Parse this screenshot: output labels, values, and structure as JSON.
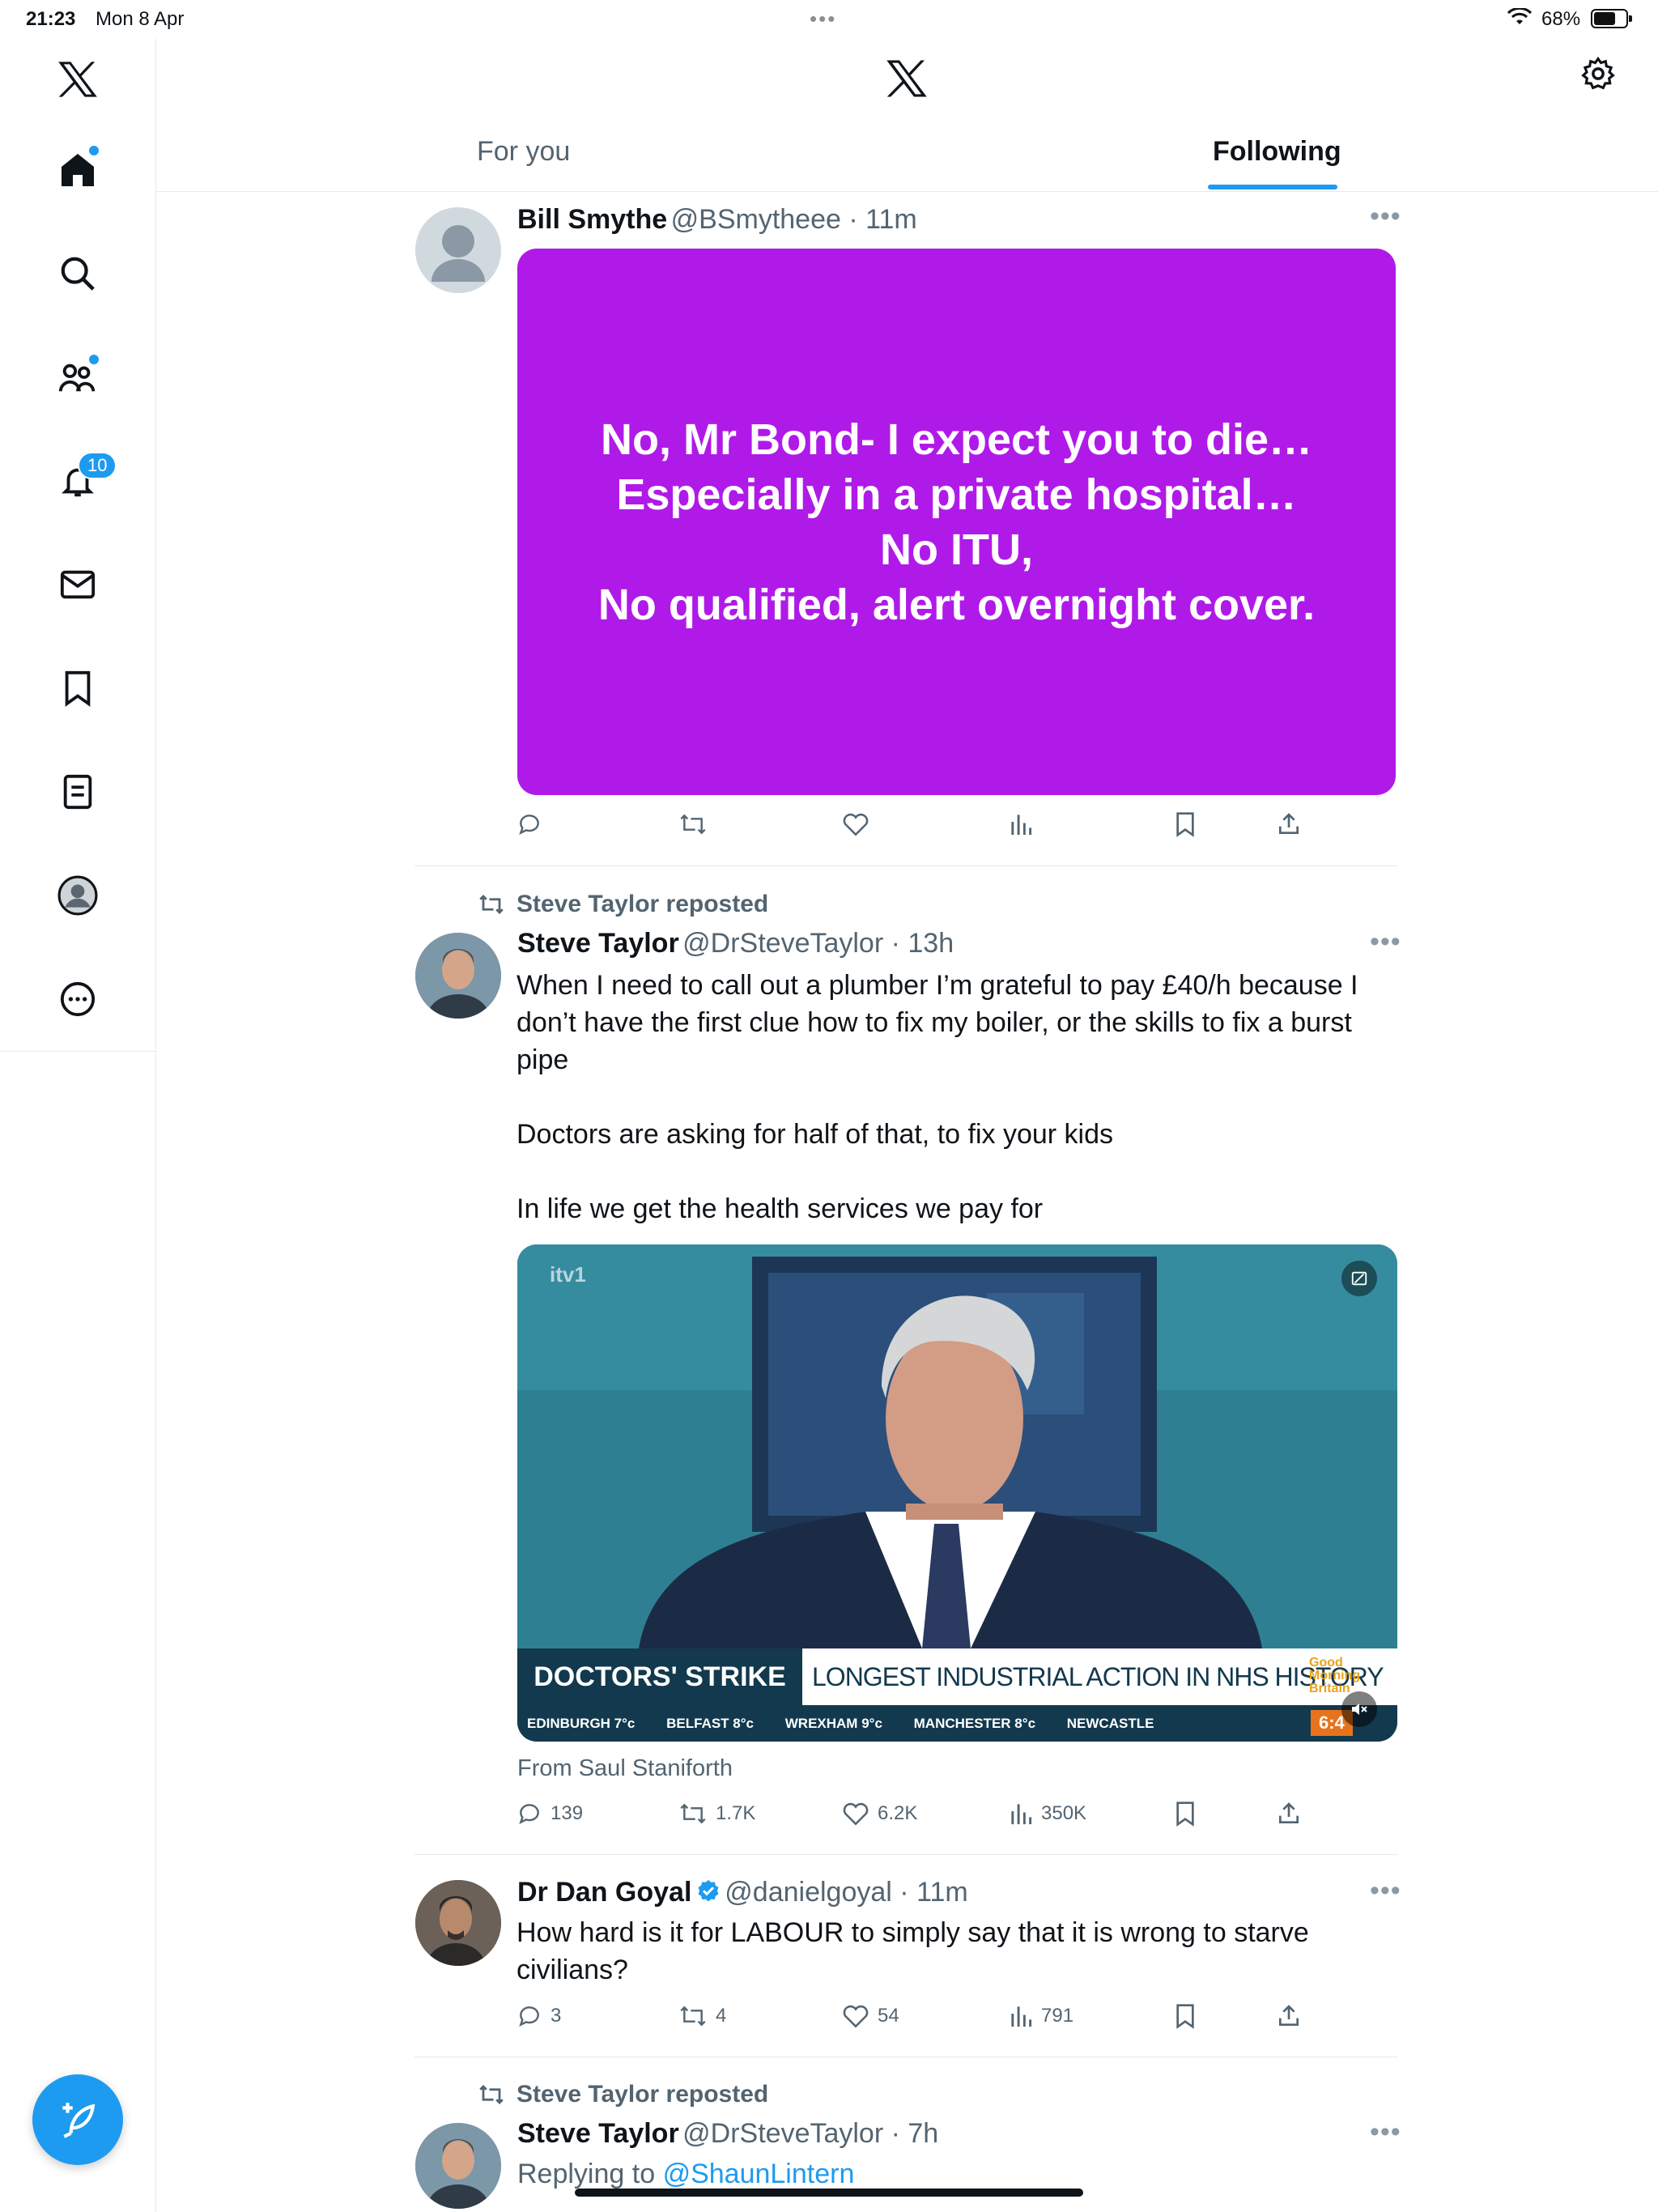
{
  "status_bar": {
    "time": "21:23",
    "date": "Mon 8 Apr",
    "battery": "68%",
    "battery_level": 0.68
  },
  "sidebar": {
    "notifications_badge": "10",
    "items": [
      "home",
      "explore",
      "communities",
      "notifications",
      "messages",
      "bookmarks",
      "lists",
      "profile",
      "more"
    ]
  },
  "header": {
    "tabs": [
      {
        "label": "For you",
        "active": false
      },
      {
        "label": "Following",
        "active": true
      }
    ]
  },
  "feed": [
    {
      "name": "Bill Smythe",
      "handle": "@BSmytheee",
      "time": "11m",
      "card_lines": [
        "No, Mr Bond- I expect you to die…",
        "Especially in a private hospital…",
        "No ITU,",
        "No qualified, alert overnight cover."
      ],
      "card_color": "#b01ae8"
    },
    {
      "reposted_by": "Steve Taylor reposted",
      "name": "Steve Taylor",
      "handle": "@DrSteveTaylor",
      "time": "13h",
      "text_lines": [
        "When I need to call out a plumber I’m grateful to pay £40/h because I",
        "don’t have the first clue how to fix my boiler, or the skills to fix a burst",
        "pipe",
        "Doctors are asking for half of that, to fix your kids",
        "In life we get the health services we pay for"
      ],
      "video": {
        "channel": "itv1",
        "ticker_left": "DOCTORS' STRIKE",
        "ticker_right": "LONGEST INDUSTRIAL ACTION IN NHS HISTORY",
        "show_logo": "Good Morning Britain",
        "weather": [
          "EDINBURGH 7°c",
          "BELFAST 8°c",
          "WREXHAM 9°c",
          "MANCHESTER 8°c",
          "NEWCASTLE"
        ],
        "clock": "6:4"
      },
      "from": "From Saul Staniforth",
      "stats": {
        "replies": "139",
        "reposts": "1.7K",
        "likes": "6.2K",
        "views": "350K"
      }
    },
    {
      "name": "Dr Dan Goyal",
      "handle": "@danielgoyal",
      "time": "11m",
      "verified": true,
      "text_lines": [
        "How hard is it for LABOUR to simply say that it is wrong to starve",
        "civilians?"
      ],
      "stats": {
        "replies": "3",
        "reposts": "4",
        "likes": "54",
        "views": "791"
      }
    },
    {
      "reposted_by": "Steve Taylor reposted",
      "name": "Steve Taylor",
      "handle": "@DrSteveTaylor",
      "time": "7h",
      "reply_prefix": "Replying to",
      "reply_to": "@ShaunLintern"
    }
  ],
  "colors": {
    "accent": "#1d9bf0",
    "text": "#0f1419",
    "muted": "#536471"
  }
}
